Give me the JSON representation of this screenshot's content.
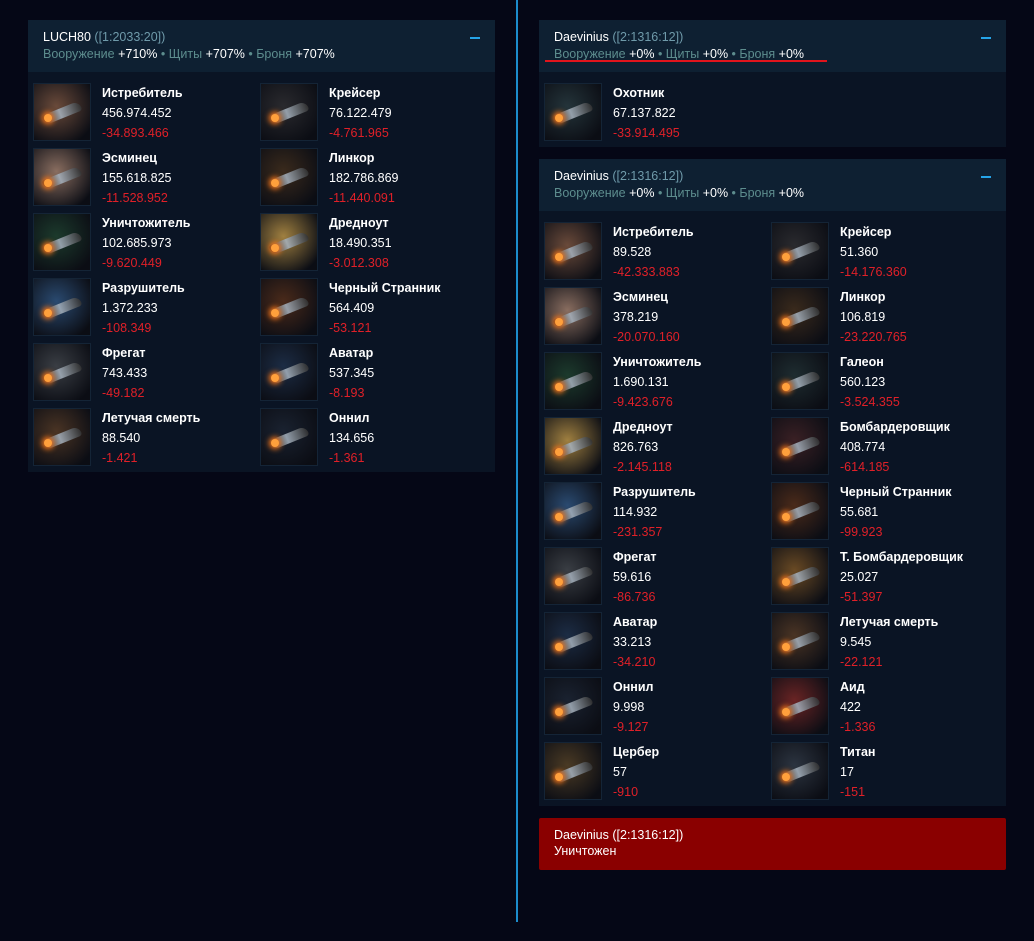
{
  "left_fleets": [
    {
      "name": "LUCH80",
      "coords": "([1:2033:20])",
      "stats": {
        "weapons_label": "Вооружение",
        "weapons": "+710%",
        "shields_label": "Щиты",
        "shields": "+707%",
        "armor_label": "Броня",
        "armor": "+707%"
      },
      "ships": [
        {
          "name": "Истребитель",
          "count": "456.974.452",
          "loss": "-34.893.466",
          "icon": "fighter-icon",
          "tint": "#6a4a3a"
        },
        {
          "name": "Крейсер",
          "count": "76.122.479",
          "loss": "-4.761.965",
          "icon": "cruiser-icon",
          "tint": "#2a2a2e"
        },
        {
          "name": "Эсминец",
          "count": "155.618.825",
          "loss": "-11.528.952",
          "icon": "destroyer-icon",
          "tint": "#8a6e60"
        },
        {
          "name": "Линкор",
          "count": "182.786.869",
          "loss": "-11.440.091",
          "icon": "battleship-icon",
          "tint": "#3a2a1c"
        },
        {
          "name": "Уничтожитель",
          "count": "102.685.973",
          "loss": "-9.620.449",
          "icon": "annihilator-icon",
          "tint": "#1c3a2c"
        },
        {
          "name": "Дредноут",
          "count": "18.490.351",
          "loss": "-3.012.308",
          "icon": "dreadnought-icon",
          "tint": "#a08040"
        },
        {
          "name": "Разрушитель",
          "count": "1.372.233",
          "loss": "-108.349",
          "icon": "wrecker-icon",
          "tint": "#2a4a70"
        },
        {
          "name": "Черный Странник",
          "count": "564.409",
          "loss": "-53.121",
          "icon": "black-wanderer-icon",
          "tint": "#4a2a1a"
        },
        {
          "name": "Фрегат",
          "count": "743.433",
          "loss": "-49.182",
          "icon": "frigate-icon",
          "tint": "#3a3e44"
        },
        {
          "name": "Аватар",
          "count": "537.345",
          "loss": "-8.193",
          "icon": "avatar-icon",
          "tint": "#1c2c44"
        },
        {
          "name": "Летучая смерть",
          "count": "88.540",
          "loss": "-1.421",
          "icon": "flying-death-icon",
          "tint": "#4a3424"
        },
        {
          "name": "Оннил",
          "count": "134.656",
          "loss": "-1.361",
          "icon": "onnil-icon",
          "tint": "#1a2230"
        }
      ]
    }
  ],
  "right_fleets": [
    {
      "name": "Daevinius",
      "coords": "([2:1316:12])",
      "underline": true,
      "stats": {
        "weapons_label": "Вооружение",
        "weapons": "+0%",
        "shields_label": "Щиты",
        "shields": "+0%",
        "armor_label": "Броня",
        "armor": "+0%"
      },
      "ships": [
        {
          "name": "Охотник",
          "count": "67.137.822",
          "loss": "-33.914.495",
          "icon": "hunter-icon",
          "tint": "#24343a"
        }
      ]
    },
    {
      "name": "Daevinius",
      "coords": "([2:1316:12])",
      "underline": false,
      "stats": {
        "weapons_label": "Вооружение",
        "weapons": "+0%",
        "shields_label": "Щиты",
        "shields": "+0%",
        "armor_label": "Броня",
        "armor": "+0%"
      },
      "ships": [
        {
          "name": "Истребитель",
          "count": "89.528",
          "loss": "-42.333.883",
          "icon": "fighter-icon",
          "tint": "#6a4a3a"
        },
        {
          "name": "Крейсер",
          "count": "51.360",
          "loss": "-14.176.360",
          "icon": "cruiser-icon",
          "tint": "#2a2a2e"
        },
        {
          "name": "Эсминец",
          "count": "378.219",
          "loss": "-20.070.160",
          "icon": "destroyer-icon",
          "tint": "#8a6e60"
        },
        {
          "name": "Линкор",
          "count": "106.819",
          "loss": "-23.220.765",
          "icon": "battleship-icon",
          "tint": "#3a2a1c"
        },
        {
          "name": "Уничтожитель",
          "count": "1.690.131",
          "loss": "-9.423.676",
          "icon": "annihilator-icon",
          "tint": "#1c3a2c"
        },
        {
          "name": "Галеон",
          "count": "560.123",
          "loss": "-3.524.355",
          "icon": "galleon-icon",
          "tint": "#1e2c30"
        },
        {
          "name": "Дредноут",
          "count": "826.763",
          "loss": "-2.145.118",
          "icon": "dreadnought-icon",
          "tint": "#a08040"
        },
        {
          "name": "Бомбардеровщик",
          "count": "408.774",
          "loss": "-614.185",
          "icon": "bomber-icon",
          "tint": "#3a2024"
        },
        {
          "name": "Разрушитель",
          "count": "114.932",
          "loss": "-231.357",
          "icon": "wrecker-icon",
          "tint": "#2a4a70"
        },
        {
          "name": "Черный Странник",
          "count": "55.681",
          "loss": "-99.923",
          "icon": "black-wanderer-icon",
          "tint": "#4a2a1a"
        },
        {
          "name": "Фрегат",
          "count": "59.616",
          "loss": "-86.736",
          "icon": "frigate-icon",
          "tint": "#3a3e44"
        },
        {
          "name": "Т. Бомбардеровщик",
          "count": "25.027",
          "loss": "-51.397",
          "icon": "heavy-bomber-icon",
          "tint": "#6a4a24"
        },
        {
          "name": "Аватар",
          "count": "33.213",
          "loss": "-34.210",
          "icon": "avatar-icon",
          "tint": "#1c2c44"
        },
        {
          "name": "Летучая смерть",
          "count": "9.545",
          "loss": "-22.121",
          "icon": "flying-death-icon",
          "tint": "#4a3424"
        },
        {
          "name": "Оннил",
          "count": "9.998",
          "loss": "-9.127",
          "icon": "onnil-icon",
          "tint": "#1a2230"
        },
        {
          "name": "Аид",
          "count": "422",
          "loss": "-1.336",
          "icon": "hades-icon",
          "tint": "#6a2424"
        },
        {
          "name": "Цербер",
          "count": "57",
          "loss": "-910",
          "icon": "cerberus-icon",
          "tint": "#4a3a24"
        },
        {
          "name": "Титан",
          "count": "17",
          "loss": "-151",
          "icon": "titan-icon",
          "tint": "#2c3440"
        }
      ]
    }
  ],
  "destroyed": {
    "name": "Daevinius",
    "coords": "([2:1316:12])",
    "status": "Уничтожен"
  },
  "colors": {
    "background": "#050716",
    "panel": "#0a1424",
    "panel_header": "#0e2032",
    "loss": "#e02028",
    "divider": "#1c8ccc",
    "destroyed": "#8a0000"
  }
}
